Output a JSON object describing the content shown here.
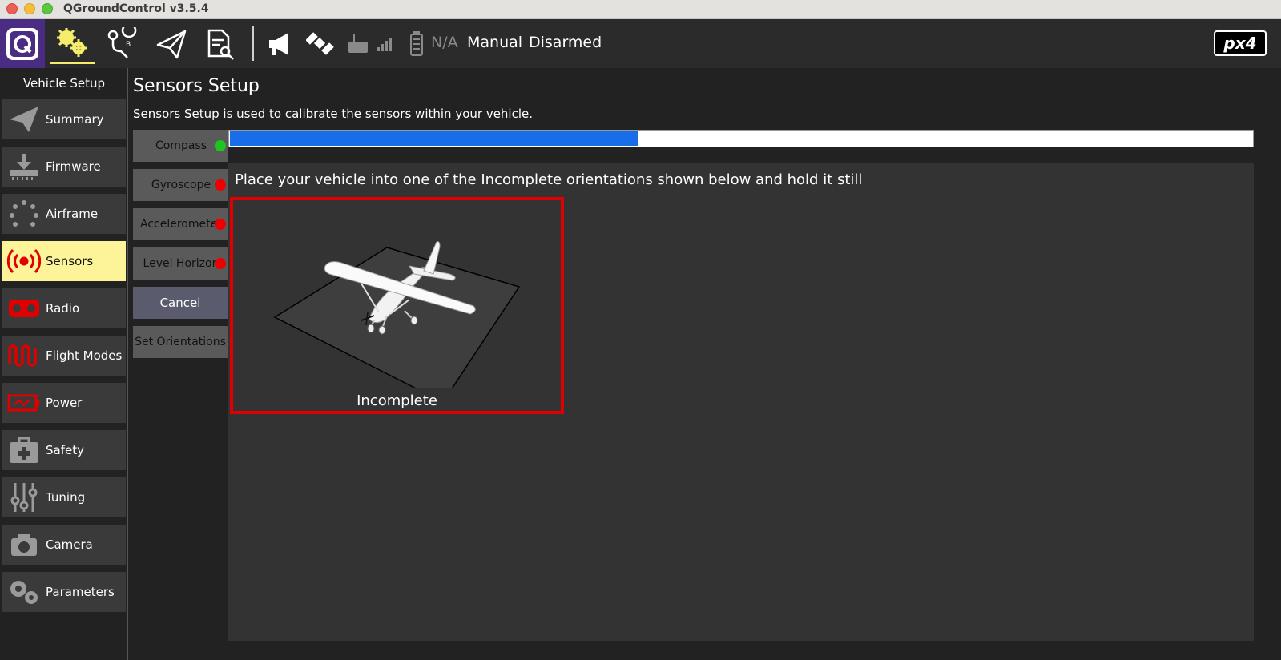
{
  "window": {
    "title": "QGroundControl v3.5.4"
  },
  "toolbar": {
    "battery": "N/A",
    "flight_mode": "Manual",
    "arm_state": "Disarmed",
    "brand": "px4"
  },
  "sidebar": {
    "header": "Vehicle Setup",
    "items": [
      {
        "label": "Summary",
        "icon": "plane-icon"
      },
      {
        "label": "Firmware",
        "icon": "firmware-download-icon"
      },
      {
        "label": "Airframe",
        "icon": "airframe-dots-icon"
      },
      {
        "label": "Sensors",
        "icon": "sensors-radio-icon",
        "active": true
      },
      {
        "label": "Radio",
        "icon": "radio-icon"
      },
      {
        "label": "Flight Modes",
        "icon": "flight-modes-wave-icon"
      },
      {
        "label": "Power",
        "icon": "battery-power-icon"
      },
      {
        "label": "Safety",
        "icon": "first-aid-kit-icon"
      },
      {
        "label": "Tuning",
        "icon": "sliders-icon"
      },
      {
        "label": "Camera",
        "icon": "camera-icon"
      },
      {
        "label": "Parameters",
        "icon": "gears-icon"
      }
    ]
  },
  "main": {
    "title": "Sensors Setup",
    "description": "Sensors Setup is used to calibrate the sensors within your vehicle.",
    "sensors": [
      {
        "label": "Compass",
        "status_color": "#1ec51e"
      },
      {
        "label": "Gyroscope",
        "status_color": "#ee0000"
      },
      {
        "label": "Accelerometer",
        "status_color": "#ee0000"
      },
      {
        "label": "Level Horizon",
        "status_color": "#ee0000"
      }
    ],
    "cancel_label": "Cancel",
    "set_orientations_label": "Set Orientations",
    "progress": 0.4,
    "instruction": "Place your vehicle into one of the Incomplete orientations shown below and hold it still",
    "orientation_status": "Incomplete"
  },
  "colors": {
    "accent_yellow": "#fdf49a",
    "progress_blue": "#1a6de8",
    "highlight_red": "#e00000",
    "brand_purple": "#4b2c83"
  }
}
